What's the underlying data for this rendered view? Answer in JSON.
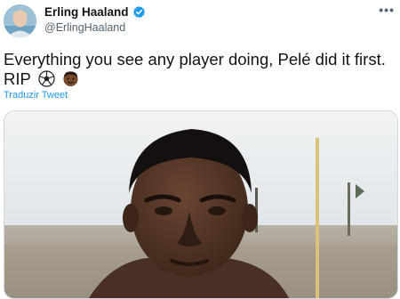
{
  "tweet": {
    "author": {
      "display_name": "Erling Haaland",
      "handle": "@ErlingHaaland",
      "verified": true,
      "avatar_icon": "avatar-photo",
      "verified_color": "#1d9bf0"
    },
    "more_label": "•••",
    "text": "Everything you see any player doing, Pelé did it first.",
    "text_line2": "RIP",
    "emojis": [
      "soccer-ball-icon",
      "man-dark-skin-icon"
    ],
    "translate_label": "Traduzir Tweet",
    "media": {
      "type": "photo",
      "icon": "photo-pele-stadium"
    },
    "colors": {
      "link": "#1d9bf0",
      "secondary": "#536471",
      "text": "#0f1419"
    }
  }
}
